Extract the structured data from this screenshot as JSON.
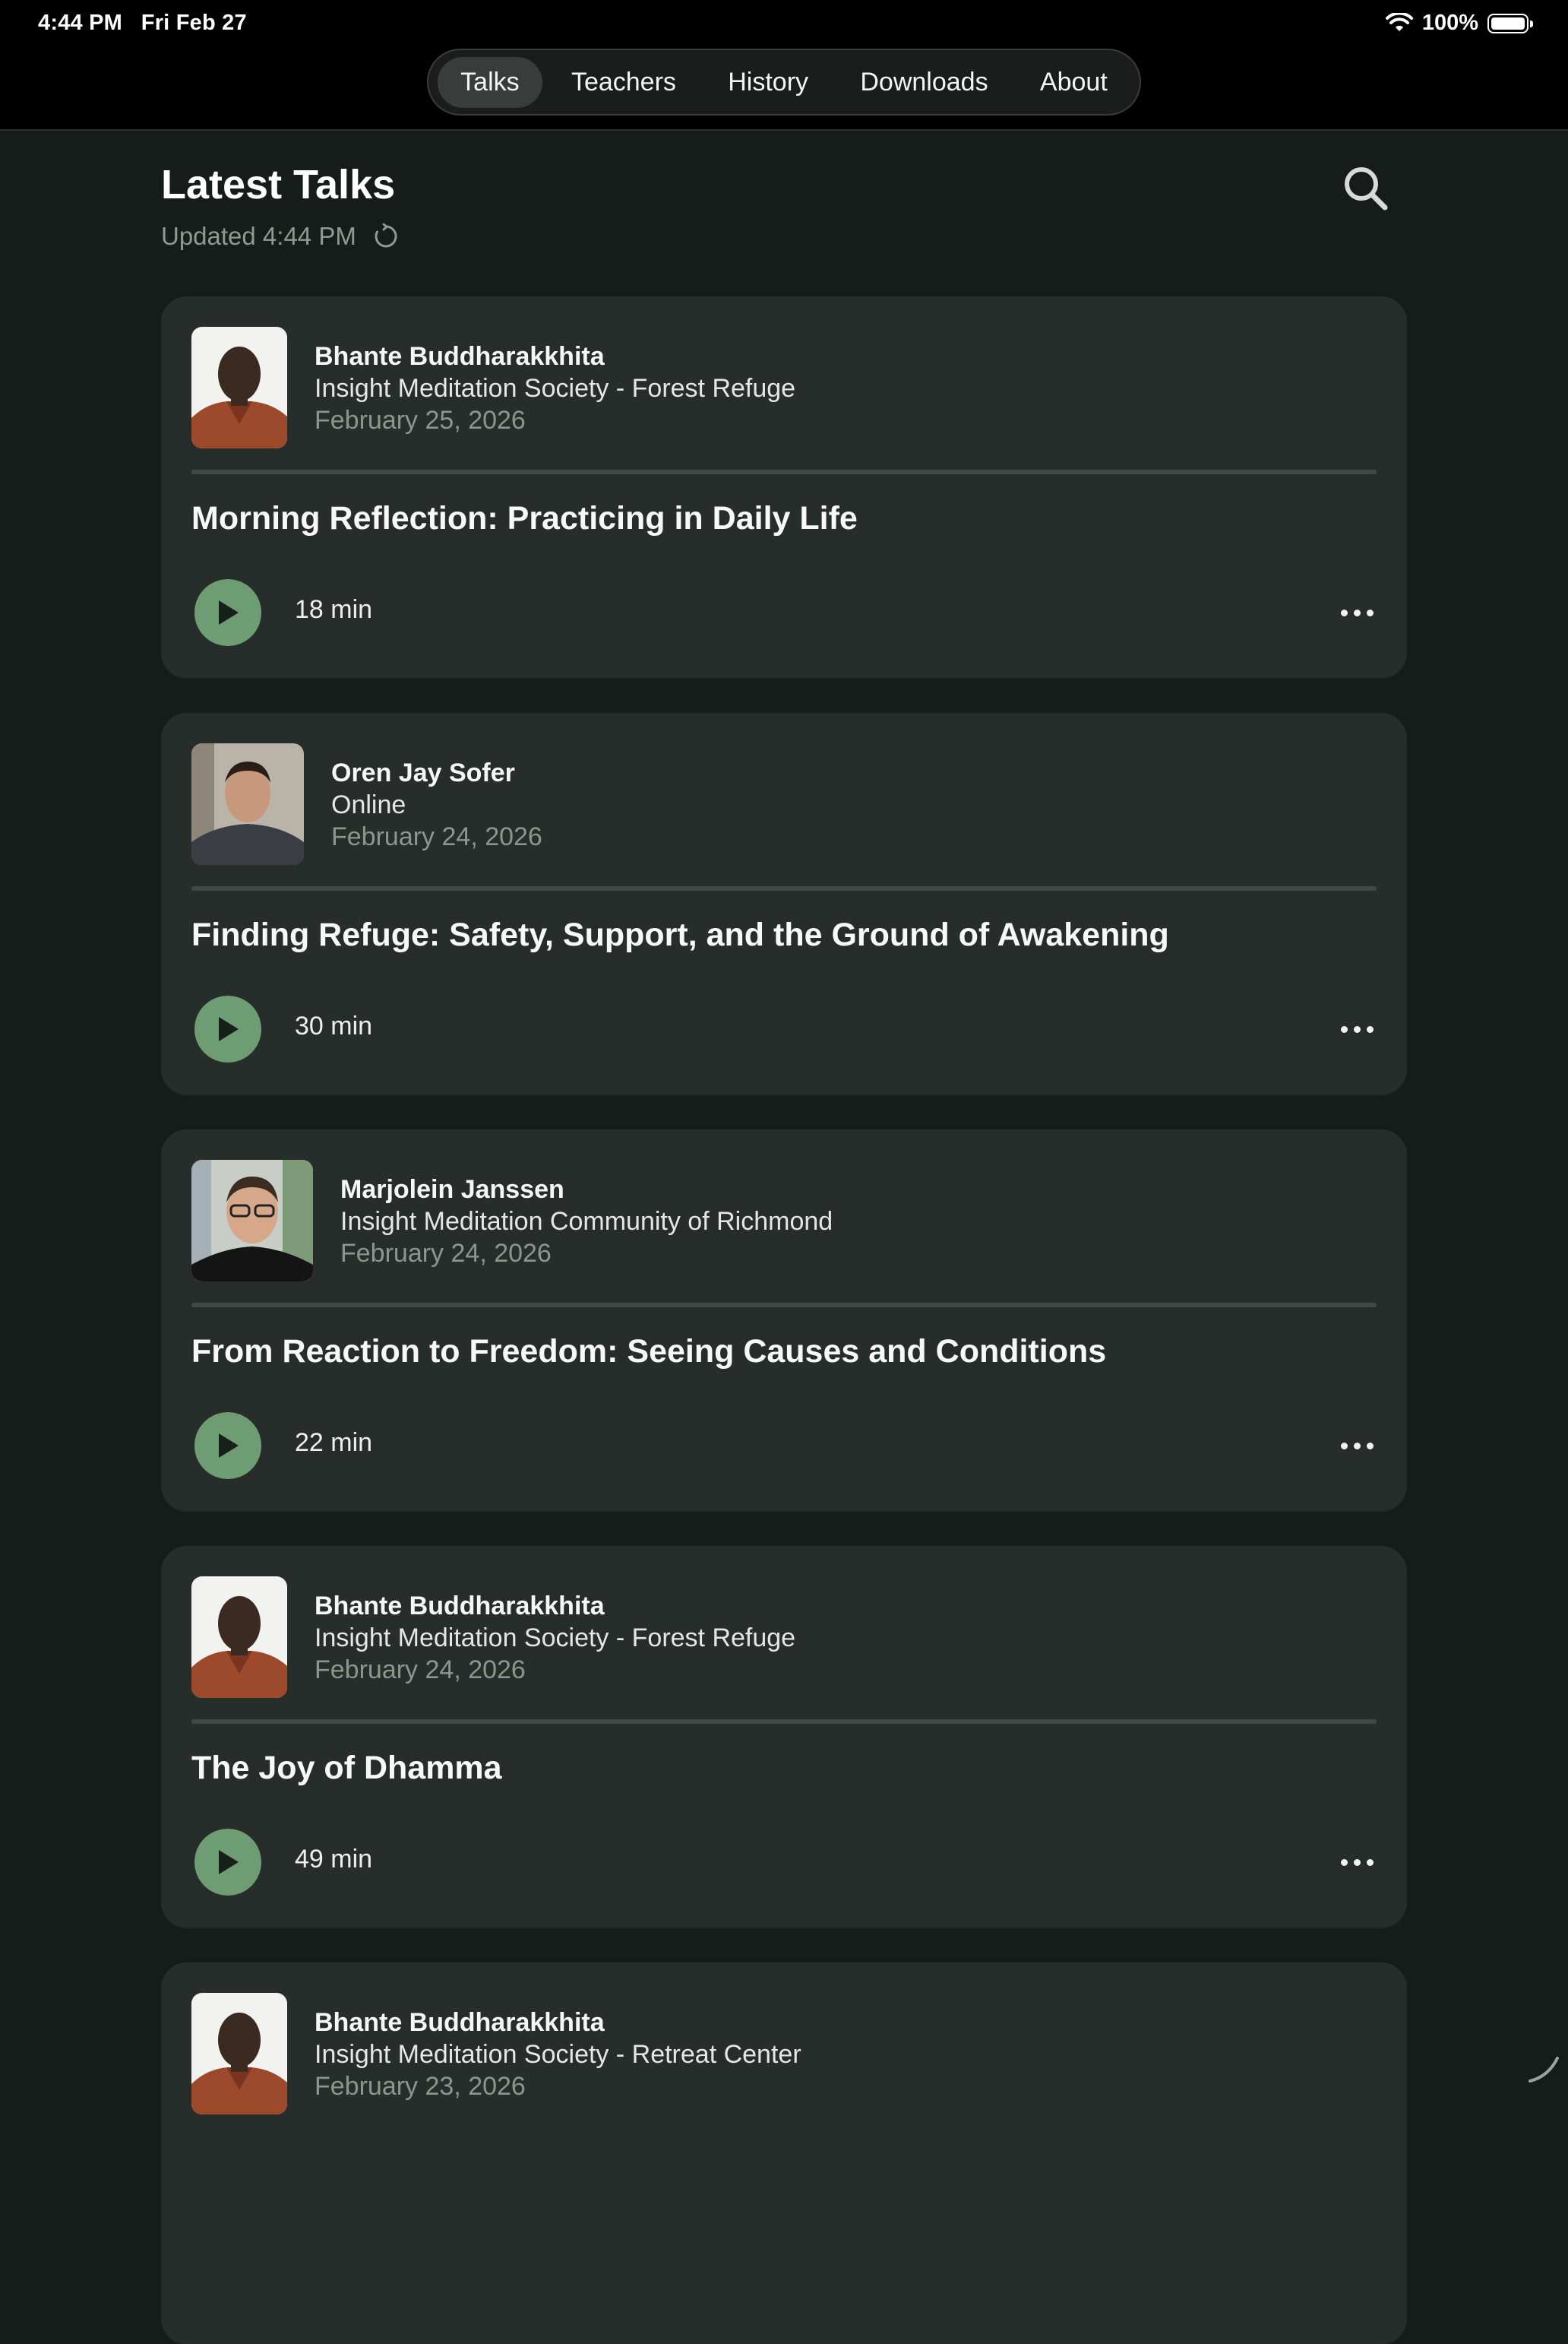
{
  "status_bar": {
    "time": "4:44 PM",
    "date": "Fri Feb 27",
    "battery": "100%"
  },
  "nav": {
    "tabs": [
      {
        "label": "Talks",
        "active": true
      },
      {
        "label": "Teachers"
      },
      {
        "label": "History"
      },
      {
        "label": "Downloads"
      },
      {
        "label": "About"
      }
    ]
  },
  "header": {
    "title": "Latest Talks",
    "updated": "Updated 4:44 PM"
  },
  "talks": [
    {
      "teacher": "Bhante Buddharakkhita",
      "venue": "Insight Meditation Society - Forest Refuge",
      "date": "February 25, 2026",
      "title": "Morning Reflection: Practicing in Daily Life",
      "duration": "18 min"
    },
    {
      "teacher": "Oren Jay Sofer",
      "venue": "Online",
      "date": "February 24, 2026",
      "title": "Finding Refuge: Safety, Support, and the Ground of Awakening",
      "duration": "30 min"
    },
    {
      "teacher": "Marjolein Janssen",
      "venue": "Insight Meditation Community of Richmond",
      "date": "February 24, 2026",
      "title": "From Reaction to Freedom: Seeing Causes and Conditions",
      "duration": "22 min"
    },
    {
      "teacher": "Bhante Buddharakkhita",
      "venue": "Insight Meditation Society - Forest Refuge",
      "date": "February 24, 2026",
      "title": "The Joy of Dhamma",
      "duration": "49 min"
    },
    {
      "teacher": "Bhante Buddharakkhita",
      "venue": "Insight Meditation Society - Retreat Center",
      "date": "February 23, 2026",
      "title": "",
      "duration": ""
    }
  ],
  "colors": {
    "background": "#161c19",
    "card": "#272d2a",
    "accent": "#6e9c73",
    "muted_text": "#8b968f"
  }
}
